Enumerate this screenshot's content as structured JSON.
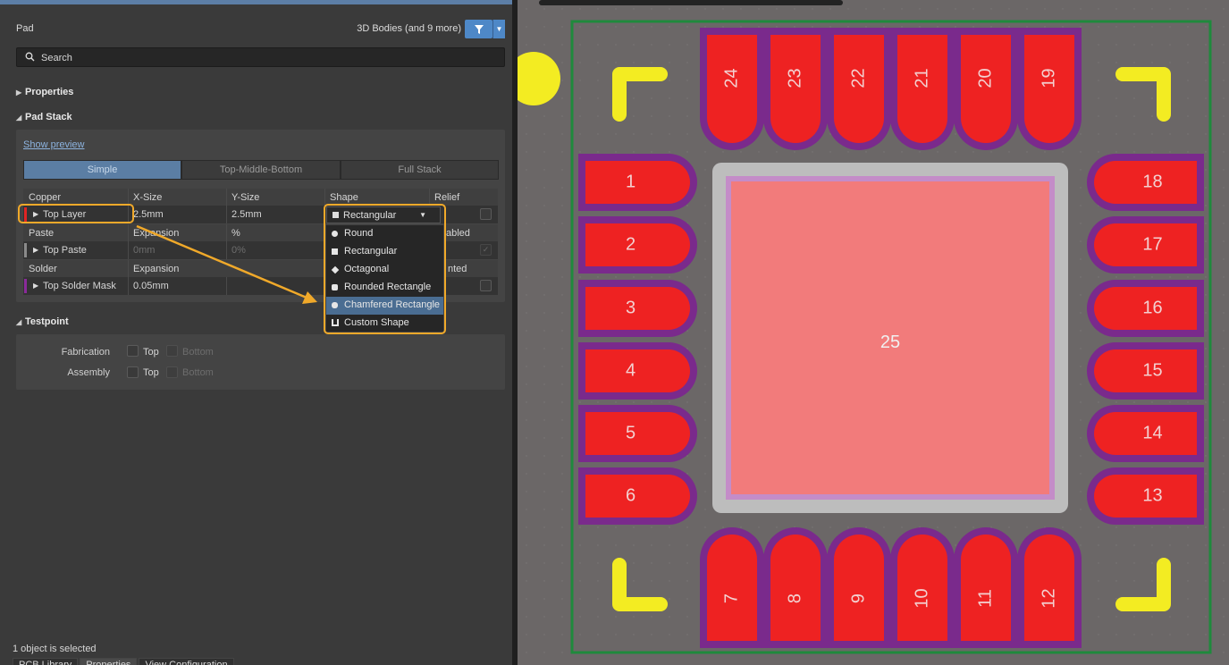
{
  "panel": {
    "object_type": "Pad",
    "filter_label": "3D Bodies (and 9 more)",
    "search_placeholder": "Search",
    "sections": {
      "properties": "Properties",
      "pad_stack": "Pad Stack",
      "testpoint": "Testpoint"
    },
    "show_preview": "Show preview",
    "modes": [
      "Simple",
      "Top-Middle-Bottom",
      "Full Stack"
    ],
    "active_mode": "Simple",
    "copper": {
      "headers": [
        "Copper",
        "X-Size",
        "Y-Size",
        "Shape",
        "Relief"
      ],
      "row": {
        "layer": "Top Layer",
        "x_size": "2.5mm",
        "y_size": "2.5mm",
        "shape": "Rectangular"
      }
    },
    "paste": {
      "headers": [
        "Paste",
        "Expansion",
        "%",
        "Enabled"
      ],
      "visible_headers": [
        "Paste",
        "Expansion",
        "%",
        "abled"
      ],
      "row": {
        "layer": "Top Paste",
        "expansion": "0mm",
        "percent": "0%"
      }
    },
    "solder": {
      "headers": [
        "Solder",
        "Expansion",
        "Tented"
      ],
      "visible_headers": [
        "Solder",
        "Expansion",
        "nted"
      ],
      "row": {
        "layer": "Top Solder Mask",
        "expansion": "0.05mm"
      }
    },
    "shape_options": [
      "Round",
      "Rectangular",
      "Octagonal",
      "Rounded Rectangle",
      "Chamfered Rectangle",
      "Custom Shape"
    ],
    "shape_highlighted": "Chamfered Rectangle",
    "testpoint": {
      "rows": [
        {
          "label": "Fabrication",
          "top": "Top",
          "bottom": "Bottom"
        },
        {
          "label": "Assembly",
          "top": "Top",
          "bottom": "Bottom"
        }
      ]
    },
    "status": "1 object is selected",
    "bottom_tabs": [
      "PCB Library",
      "Properties",
      "View Configuration"
    ]
  },
  "colors": {
    "pad_red": "#ee2222",
    "solder_mask_purple": "#7a2a8c",
    "silkscreen_yellow": "#f3ec22",
    "board_outline_green": "#1f8a3c",
    "thermal_pad_fill": "#f27b7b",
    "highlight_orange": "#f0a92a",
    "active_mode_blue": "#5b7ea4"
  },
  "pcb": {
    "top_pads": [
      "24",
      "23",
      "22",
      "21",
      "20",
      "19"
    ],
    "bottom_pads": [
      "7",
      "8",
      "9",
      "10",
      "11",
      "12"
    ],
    "left_pads": [
      "1",
      "2",
      "3",
      "4",
      "5",
      "6"
    ],
    "right_pads": [
      "18",
      "17",
      "16",
      "15",
      "14",
      "13"
    ],
    "center_pad": "25"
  }
}
